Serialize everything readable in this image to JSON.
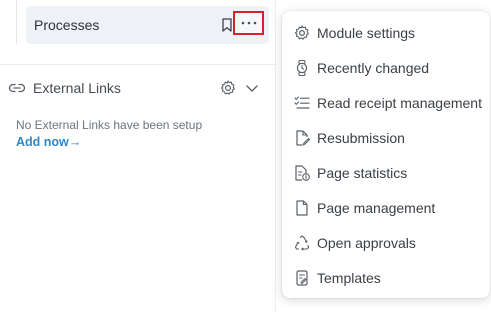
{
  "sidebar": {
    "process_label": "Processes",
    "external_links_label": "External Links",
    "empty_message": "No External Links have been setup",
    "add_now_label": "Add now→"
  },
  "menu": {
    "items": [
      {
        "label": "Module settings",
        "icon": "gear-icon"
      },
      {
        "label": "Recently changed",
        "icon": "watch-icon"
      },
      {
        "label": "Read receipt management",
        "icon": "checklist-icon"
      },
      {
        "label": "Resubmission",
        "icon": "document-pen-icon"
      },
      {
        "label": "Page statistics",
        "icon": "document-info-icon"
      },
      {
        "label": "Page management",
        "icon": "page-icon"
      },
      {
        "label": "Open approvals",
        "icon": "recycle-icon"
      },
      {
        "label": "Templates",
        "icon": "template-icon"
      }
    ]
  },
  "colors": {
    "accent_link": "#2f86c9",
    "highlight_border": "#d4232d",
    "selected_row_bg": "#eef1f5"
  }
}
